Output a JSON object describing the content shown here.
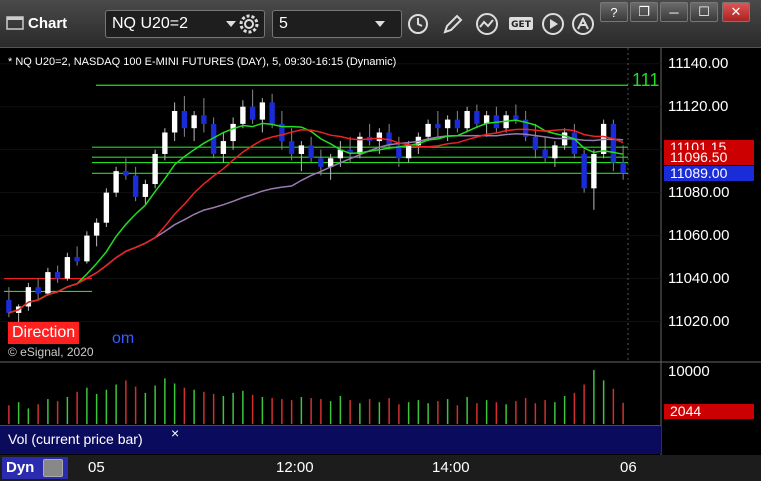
{
  "window": {
    "title": "Chart",
    "symbol": "NQ U20=2",
    "interval": "5",
    "buttons": {
      "help": "?",
      "restore": "❐",
      "minimize": "─",
      "maximize": "☐",
      "close": "✕"
    }
  },
  "chart_header": "* NQ U20=2, NASDAQ 100 E-MINI FUTURES (DAY), 5, 09:30-16:15 (Dynamic)",
  "overlay_level_text": "111",
  "branding": {
    "badge": "Direction",
    "copyright": "© eSignal, 2020",
    "link_fragment": "om"
  },
  "price_axis": {
    "labels": [
      "11140.00",
      "11120.00",
      "11100.00",
      "11080.00",
      "11060.00",
      "11040.00",
      "11020.00"
    ],
    "tags": [
      {
        "label": "11101.15",
        "color": "#cc0000"
      },
      {
        "label": "11096.50",
        "color": "#cc0000"
      },
      {
        "label": "11089.00",
        "color": "#1a2bd8"
      }
    ]
  },
  "volume_axis": {
    "labels": [
      "10000"
    ],
    "tag": "2044",
    "tag_color": "#cc0000"
  },
  "volume_panel": {
    "label": "Vol (current price bar)",
    "close": "×"
  },
  "time_axis": {
    "labels": [
      "05",
      "12:00",
      "14:00",
      "06"
    ]
  },
  "footer": {
    "dyn_label": "Dyn"
  },
  "colors": {
    "up": "#ffffff",
    "down": "#1a2bd8",
    "green_line": "#22dd22",
    "red_line": "#ee2222",
    "purple_line": "#9a7ab0"
  },
  "chart_data": {
    "type": "candlestick",
    "title": "NQ U20=2, NASDAQ 100 E-MINI FUTURES (DAY), 5, 09:30-16:15 (Dynamic)",
    "ylim": [
      11010,
      11145
    ],
    "horizontal_levels": [
      11130,
      11101.15,
      11096.5,
      11094,
      11089
    ],
    "last_price": 11089.0,
    "candles": [
      [
        11030,
        11036,
        11022,
        11024
      ],
      [
        11024,
        11028,
        11018,
        11027
      ],
      [
        11027,
        11038,
        11025,
        11036
      ],
      [
        11036,
        11040,
        11030,
        11033
      ],
      [
        11033,
        11045,
        11032,
        11043
      ],
      [
        11043,
        11046,
        11038,
        11040
      ],
      [
        11040,
        11052,
        11039,
        11050
      ],
      [
        11050,
        11055,
        11046,
        11048
      ],
      [
        11048,
        11062,
        11047,
        11060
      ],
      [
        11060,
        11068,
        11055,
        11066
      ],
      [
        11066,
        11082,
        11064,
        11080
      ],
      [
        11080,
        11092,
        11078,
        11090
      ],
      [
        11090,
        11096,
        11086,
        11088
      ],
      [
        11088,
        11092,
        11076,
        11078
      ],
      [
        11078,
        11086,
        11074,
        11084
      ],
      [
        11084,
        11100,
        11082,
        11098
      ],
      [
        11098,
        11110,
        11095,
        11108
      ],
      [
        11108,
        11122,
        11104,
        11118
      ],
      [
        11118,
        11125,
        11106,
        11110
      ],
      [
        11110,
        11118,
        11104,
        11116
      ],
      [
        11116,
        11124,
        11108,
        11112
      ],
      [
        11112,
        11115,
        11096,
        11098
      ],
      [
        11098,
        11108,
        11094,
        11104
      ],
      [
        11104,
        11115,
        11100,
        11112
      ],
      [
        11112,
        11123,
        11110,
        11120
      ],
      [
        11120,
        11128,
        11112,
        11114
      ],
      [
        11114,
        11124,
        11108,
        11122
      ],
      [
        11122,
        11126,
        11110,
        11112
      ],
      [
        11112,
        11118,
        11100,
        11104
      ],
      [
        11104,
        11110,
        11095,
        11098
      ],
      [
        11098,
        11104,
        11090,
        11102
      ],
      [
        11102,
        11106,
        11094,
        11096
      ],
      [
        11096,
        11100,
        11088,
        11092
      ],
      [
        11092,
        11098,
        11086,
        11096
      ],
      [
        11096,
        11104,
        11092,
        11100
      ],
      [
        11100,
        11106,
        11094,
        11098
      ],
      [
        11098,
        11108,
        11096,
        11106
      ],
      [
        11106,
        11112,
        11102,
        11104
      ],
      [
        11104,
        11110,
        11098,
        11108
      ],
      [
        11108,
        11112,
        11100,
        11102
      ],
      [
        11102,
        11106,
        11092,
        11096
      ],
      [
        11096,
        11104,
        11094,
        11102
      ],
      [
        11102,
        11108,
        11098,
        11106
      ],
      [
        11106,
        11114,
        11104,
        11112
      ],
      [
        11112,
        11118,
        11106,
        11110
      ],
      [
        11110,
        11116,
        11104,
        11114
      ],
      [
        11114,
        11118,
        11108,
        11110
      ],
      [
        11110,
        11120,
        11108,
        11118
      ],
      [
        11118,
        11121,
        11110,
        11112
      ],
      [
        11112,
        11118,
        11106,
        11116
      ],
      [
        11116,
        11120,
        11108,
        11110
      ],
      [
        11110,
        11118,
        11108,
        11116
      ],
      [
        11116,
        11121,
        11112,
        11114
      ],
      [
        11114,
        11118,
        11104,
        11106
      ],
      [
        11106,
        11112,
        11096,
        11100
      ],
      [
        11100,
        11106,
        11094,
        11096
      ],
      [
        11096,
        11104,
        11092,
        11102
      ],
      [
        11102,
        11110,
        11100,
        11108
      ],
      [
        11108,
        11112,
        11096,
        11098
      ],
      [
        11098,
        11100,
        11080,
        11082
      ],
      [
        11082,
        11100,
        11072,
        11098
      ],
      [
        11098,
        11114,
        11096,
        11112
      ],
      [
        11112,
        11114,
        11090,
        11094
      ],
      [
        11094,
        11102,
        11086,
        11089
      ]
    ],
    "volumes": [
      1800,
      2100,
      1500,
      1900,
      2400,
      2200,
      2600,
      3100,
      3500,
      2900,
      3300,
      3800,
      4200,
      3600,
      3000,
      3700,
      4400,
      3900,
      3500,
      3300,
      3100,
      2900,
      2700,
      3000,
      3200,
      2800,
      2600,
      2500,
      2400,
      2300,
      2600,
      2500,
      2400,
      2200,
      2700,
      2300,
      2000,
      2400,
      2100,
      2500,
      1900,
      2100,
      2300,
      2000,
      2200,
      2400,
      1800,
      2600,
      2000,
      2300,
      2100,
      1900,
      2200,
      2500,
      2000,
      2300,
      2100,
      2700,
      3000,
      3800,
      5200,
      4200,
      3400,
      2044
    ]
  }
}
